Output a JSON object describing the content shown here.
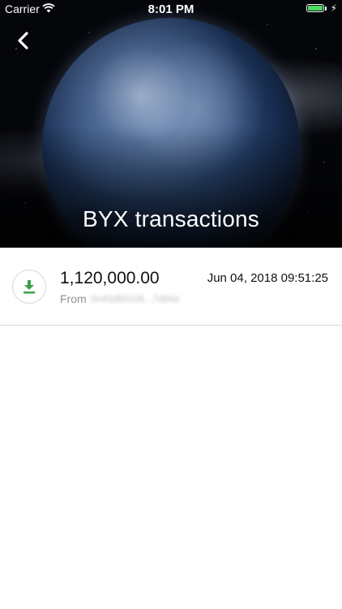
{
  "status_bar": {
    "carrier": "Carrier",
    "time": "8:01 PM",
    "battery_color": "#4cd964"
  },
  "header": {
    "title": "BYX transactions",
    "back_icon": "chevron-left-icon"
  },
  "transactions": [
    {
      "icon": "download-icon",
      "icon_color": "#3aa04a",
      "amount": "1,120,000.00",
      "date": "Jun 04, 2018 09:51:25",
      "from_label": "From",
      "address": "0x40d60106...7d84a"
    }
  ]
}
